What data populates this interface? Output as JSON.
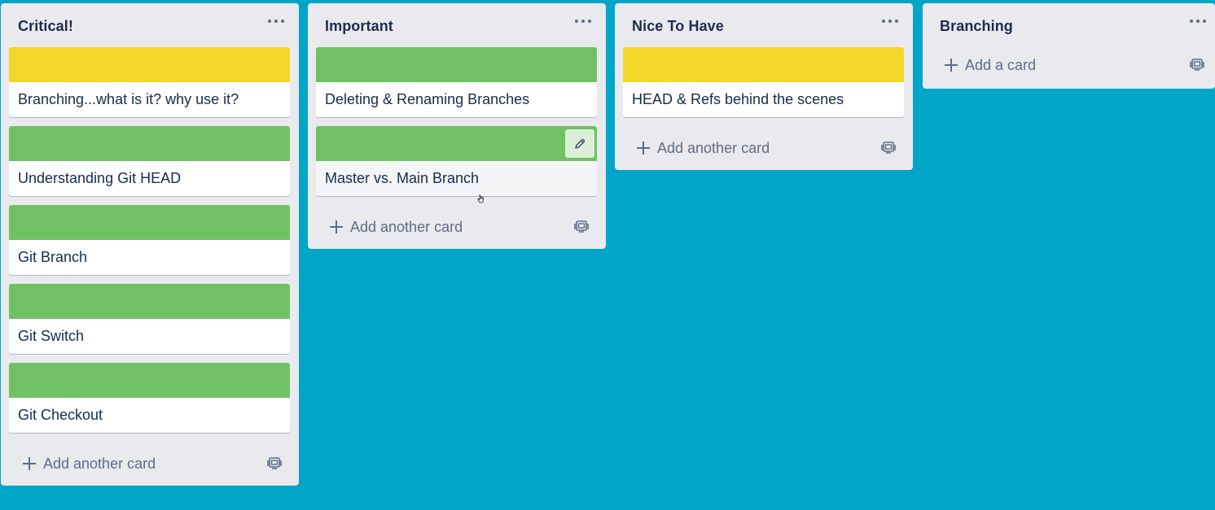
{
  "board": {
    "lists": [
      {
        "title": "Critical!",
        "menu_icon": "more-icon",
        "cards": [
          {
            "label_color": "#f2d729",
            "title": "Branching...what is it? why use it?"
          },
          {
            "label_color": "#70c164",
            "title": "Understanding Git HEAD"
          },
          {
            "label_color": "#70c164",
            "title": "Git Branch"
          },
          {
            "label_color": "#70c164",
            "title": "Git Switch"
          },
          {
            "label_color": "#70c164",
            "title": "Git Checkout"
          }
        ],
        "add_label": "Add another card"
      },
      {
        "title": "Important",
        "menu_icon": "more-icon",
        "cards": [
          {
            "label_color": "#70c164",
            "title": "Deleting & Renaming Branches"
          },
          {
            "label_color": "#70c164",
            "title": "Master vs. Main Branch",
            "hovered": true,
            "edit_icon": "pencil-icon"
          }
        ],
        "add_label": "Add another card"
      },
      {
        "title": "Nice To Have",
        "menu_icon": "more-icon",
        "cards": [
          {
            "label_color": "#f2d729",
            "title": "HEAD & Refs behind the scenes"
          }
        ],
        "add_label": "Add another card"
      },
      {
        "title": "Branching",
        "menu_icon": "more-icon",
        "cards": [],
        "add_label": "Add a card"
      }
    ],
    "background_color": "#00a5c7"
  },
  "icons": {
    "add": "plus-icon",
    "template": "card-template-icon",
    "cursor": "hand-pointer-icon"
  }
}
